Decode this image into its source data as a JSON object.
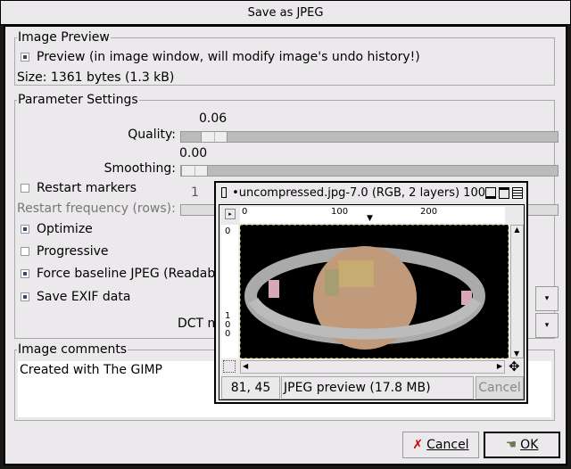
{
  "window": {
    "title": "Save as JPEG"
  },
  "image_preview": {
    "legend": "Image Preview",
    "preview_label": "Preview (in image window, will modify image's undo history!)",
    "preview_checked": true,
    "size_text": "Size: 1361 bytes (1.3 kB)"
  },
  "params": {
    "legend": "Parameter Settings",
    "quality": {
      "label": "Quality:",
      "value": "0.06"
    },
    "smoothing": {
      "label": "Smoothing:",
      "value": "0.00"
    },
    "restart_markers": {
      "label": "Restart markers",
      "checked": false
    },
    "restart_frequency": {
      "label": "Restart frequency (rows):",
      "value": "1"
    },
    "optimize": {
      "label": "Optimize",
      "checked": true
    },
    "progressive": {
      "label": "Progressive",
      "checked": false
    },
    "force_baseline": {
      "label": "Force baseline JPEG (Readabl",
      "checked": true
    },
    "save_exif": {
      "label": "Save EXIF data",
      "checked": true
    },
    "dct": {
      "label": "DCT m"
    }
  },
  "comments": {
    "legend": "Image comments",
    "text": "Created with The GIMP"
  },
  "buttons": {
    "cancel": "Cancel",
    "ok": "OK"
  },
  "gimp_window": {
    "title": "•uncompressed.jpg-7.0 (RGB, 2 layers) 100",
    "ruler_top": [
      "0",
      "100",
      "200"
    ],
    "ruler_left": [
      "0",
      "100"
    ],
    "coords": "81, 45",
    "status": "JPEG preview (17.8 MB)",
    "cancel": "Cancel"
  }
}
